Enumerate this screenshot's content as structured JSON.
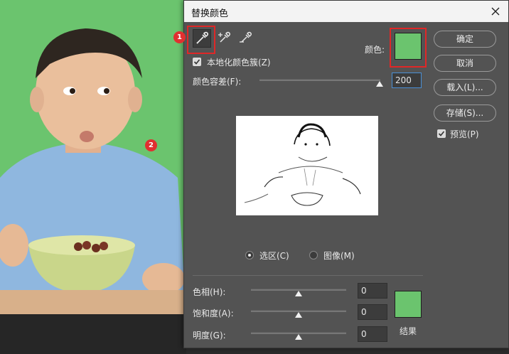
{
  "dialog": {
    "title": "替换颜色",
    "localized_clusters_label": "本地化颜色簇(Z)",
    "color_label": "颜色:",
    "tolerance_label": "颜色容差(F):",
    "tolerance_value": "200",
    "tolerance_level": 1.0,
    "buttons": {
      "ok": "确定",
      "cancel": "取消",
      "load": "载入(L)...",
      "save": "存储(S)..."
    },
    "preview_label": "预览(P)",
    "view_options": {
      "selection": "选区(C)",
      "image": "图像(M)",
      "selected": "selection"
    },
    "replacement": {
      "hue_label": "色相(H):",
      "hue_value": "0",
      "saturation_label": "饱和度(A):",
      "saturation_value": "0",
      "lightness_label": "明度(G):",
      "lightness_value": "0",
      "result_label": "结果"
    },
    "colors": {
      "sample_color": "#6bc46e",
      "result_color": "#6bc46e",
      "highlight": "#e02727"
    },
    "tools": [
      "eyedropper-icon",
      "eyedropper-plus-icon",
      "eyedropper-minus-icon"
    ]
  },
  "annotations": {
    "badge1": "1",
    "badge2": "2"
  }
}
